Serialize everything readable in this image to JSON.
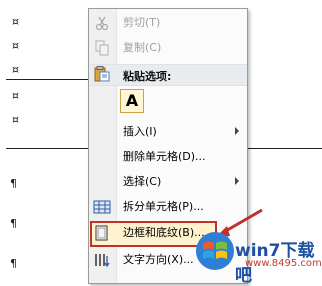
{
  "document": {
    "marks": [
      "¤",
      "¤",
      "¤",
      "¤",
      "¤",
      "¶",
      "¶",
      "¶"
    ]
  },
  "context_menu": {
    "items": [
      {
        "label": "剪切(T)",
        "icon": "scissors-icon",
        "enabled": false
      },
      {
        "label": "复制(C)",
        "icon": "copy-icon",
        "enabled": false
      },
      {
        "label": "粘贴选项:",
        "icon": "paste-icon"
      },
      {
        "label": "A",
        "icon": "paste-keep-text-icon"
      },
      {
        "label": "插入(I)",
        "submenu": true
      },
      {
        "label": "删除单元格(D)..."
      },
      {
        "label": "选择(C)",
        "submenu": true
      },
      {
        "label": "拆分单元格(P)...",
        "icon": "split-cells-icon"
      },
      {
        "label": "边框和底纹(B)...",
        "icon": "borders-icon",
        "highlighted": true
      },
      {
        "label": "文字方向(X)...",
        "icon": "text-direction-icon"
      }
    ]
  },
  "watermark": {
    "brand": "win7下载吧",
    "url": "www.8495.com"
  },
  "colors": {
    "highlight_border": "#c0312a",
    "highlight_bg": "#fff3cf",
    "brand_blue": "#1d4fa4",
    "brand_red": "#c03a2c"
  }
}
